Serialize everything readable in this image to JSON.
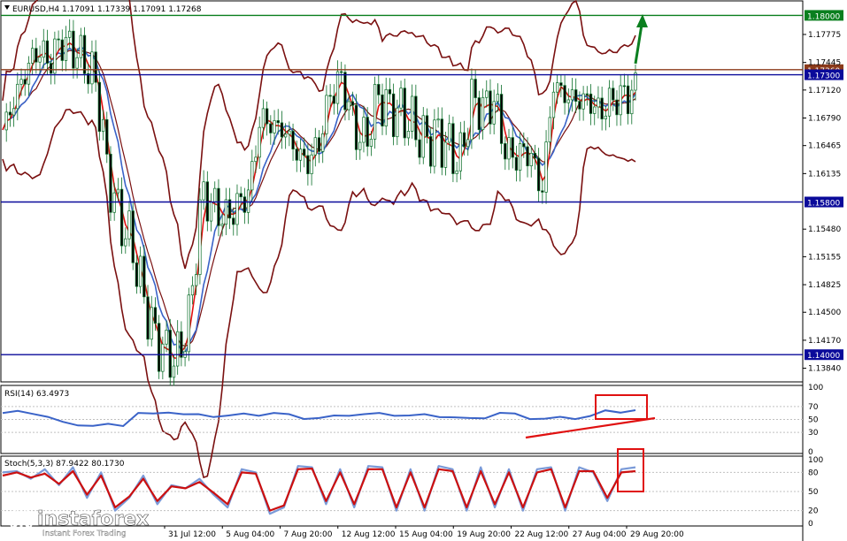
{
  "header": {
    "symbol_info": "EURUSD,H4  1.17091 1.17339 1.17091 1.17268"
  },
  "chart_data": {
    "type": "line",
    "symbol": "EURUSD",
    "timeframe": "H4",
    "ohlc": {
      "open": 1.17091,
      "high": 1.17339,
      "low": 1.17091,
      "close": 1.17268
    },
    "y_axis": {
      "range": [
        1.137,
        1.1815
      ],
      "ticks": [
        "1.17775",
        "1.17445",
        "1.17120",
        "1.16790",
        "1.16465",
        "1.16135",
        "1.15480",
        "1.15155",
        "1.14825",
        "1.14500",
        "1.14170",
        "1.13840"
      ]
    },
    "levels": [
      {
        "price": 1.18,
        "label": "1.18000",
        "kind": "target",
        "color": "#0a7f1f"
      },
      {
        "price": 1.1736,
        "label": "1.17360",
        "kind": "resistance",
        "color": "#8b3a1a"
      },
      {
        "price": 1.173,
        "label": "1.17300",
        "kind": "line",
        "color": "#0a0a9a"
      },
      {
        "price": 1.158,
        "label": "1.15800",
        "kind": "support",
        "color": "#0a0a9a"
      },
      {
        "price": 1.14,
        "label": "1.14000",
        "kind": "support",
        "color": "#0a0a9a"
      }
    ],
    "x_axis": {
      "labels": [
        "31 Jul 12:00",
        "5 Aug 04:00",
        "7 Aug 20:00",
        "12 Aug 12:00",
        "15 Aug 04:00",
        "19 Aug 20:00",
        "22 Aug 12:00",
        "27 Aug 04:00",
        "29 Aug 20:00"
      ]
    },
    "price_path": [
      1.1665,
      1.17,
      1.1735,
      1.176,
      1.1745,
      1.177,
      1.176,
      1.1745,
      1.172,
      1.161,
      1.156,
      1.153,
      1.147,
      1.142,
      1.14,
      1.1395,
      1.145,
      1.159,
      1.1575,
      1.156,
      1.1575,
      1.159,
      1.168,
      1.167,
      1.1665,
      1.164,
      1.1625,
      1.165,
      1.171,
      1.1725,
      1.1665,
      1.165,
      1.1705,
      1.169,
      1.1685,
      1.167,
      1.165,
      1.166,
      1.1645,
      1.1625,
      1.17,
      1.169,
      1.17,
      1.1635,
      1.1635,
      1.164,
      1.159,
      1.172,
      1.1705,
      1.17,
      1.17,
      1.1685,
      1.17,
      1.1705,
      1.171
    ],
    "rsi": {
      "label": "RSI(14) 63.4973",
      "period": 14,
      "value": 63.4973,
      "levels": [
        "100",
        "70",
        "50",
        "30",
        "0"
      ],
      "path": [
        60,
        62,
        60,
        54,
        45,
        42,
        40,
        42,
        41,
        60,
        58,
        62,
        58,
        57,
        55,
        56,
        58,
        57,
        60,
        57,
        52,
        52,
        55,
        57,
        58,
        59,
        57,
        56,
        57,
        55,
        53,
        51,
        53,
        60,
        58,
        52,
        51,
        53,
        52,
        55,
        63,
        62,
        64
      ]
    },
    "stochastic": {
      "label": "Stoch(5,3,3) 87.9422 80.1730",
      "params": [
        5,
        3,
        3
      ],
      "main": 87.9422,
      "signal": 80.173,
      "levels": [
        "100",
        "80",
        "50",
        "20",
        "0"
      ],
      "main_path": [
        80,
        82,
        70,
        85,
        60,
        88,
        40,
        80,
        20,
        40,
        75,
        30,
        60,
        55,
        70,
        45,
        25,
        85,
        80,
        15,
        25,
        90,
        88,
        30,
        85,
        25,
        90,
        88,
        20,
        85,
        20,
        90,
        85,
        20,
        88,
        25,
        85,
        20,
        85,
        88,
        20,
        88,
        80,
        35,
        85,
        88
      ],
      "signal_path": [
        75,
        80,
        72,
        78,
        62,
        82,
        45,
        75,
        25,
        42,
        70,
        35,
        58,
        55,
        65,
        48,
        30,
        80,
        78,
        20,
        28,
        85,
        86,
        35,
        80,
        30,
        85,
        85,
        25,
        80,
        25,
        85,
        82,
        25,
        82,
        30,
        80,
        25,
        80,
        85,
        25,
        82,
        82,
        40,
        80,
        82
      ]
    },
    "annotations": [
      {
        "type": "arrow",
        "color": "#0a7f1f",
        "meaning": "up"
      },
      {
        "type": "rectangle",
        "color": "#e01010",
        "panel": "rsi"
      },
      {
        "type": "trendline",
        "color": "#e01010",
        "panel": "rsi"
      },
      {
        "type": "rectangle",
        "color": "#e01010",
        "panel": "stochastic"
      }
    ]
  },
  "watermark": {
    "brand": "instaforex",
    "tagline": "Instant Forex Trading"
  },
  "colors": {
    "candle": "#0a6e28",
    "bollinger": "#7a1010",
    "ma_fast": "#e01010",
    "ma_slow": "#3a63c8",
    "axis_label_bg": "#0a0a9a",
    "resistance_label_bg": "#8b3a1a",
    "target_label_bg": "#0a7f1f"
  }
}
